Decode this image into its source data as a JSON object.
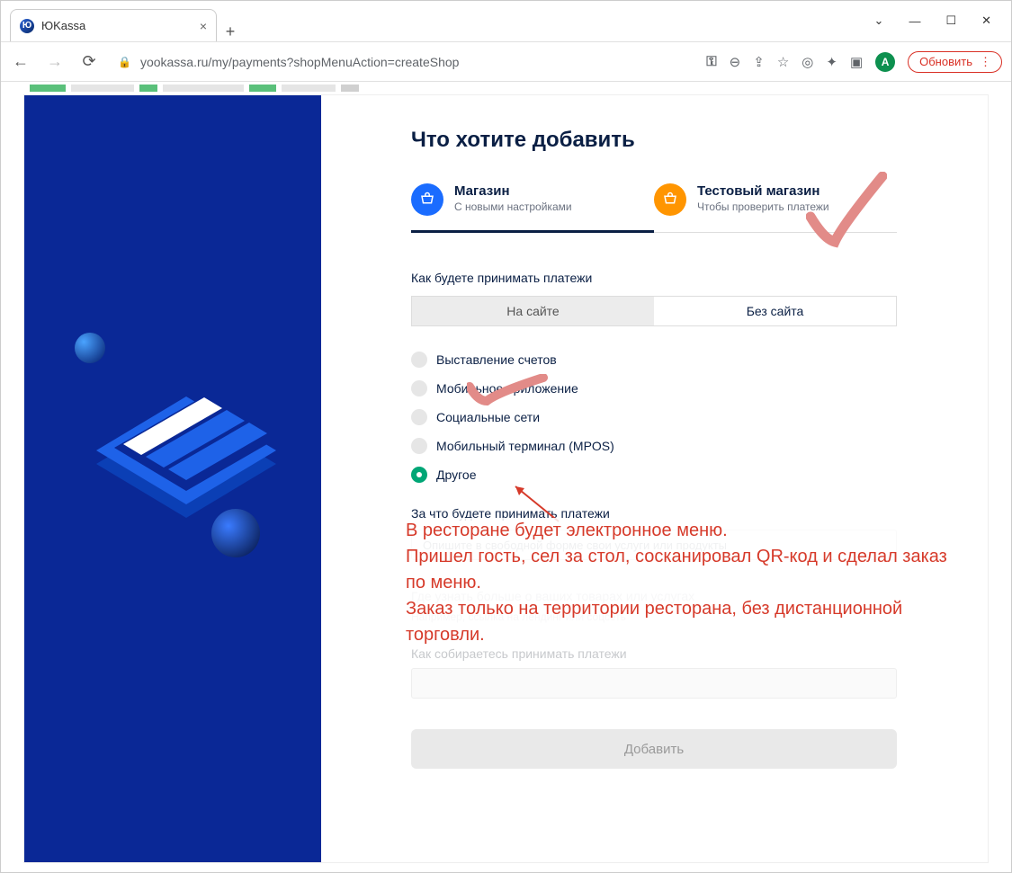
{
  "browser": {
    "tab_title": "ЮKassa",
    "url": "yookassa.ru/my/payments?shopMenuAction=createShop",
    "update_label": "Обновить",
    "avatar_letter": "A"
  },
  "page": {
    "title": "Что хотите добавить",
    "type_tabs": [
      {
        "title": "Магазин",
        "subtitle": "С новыми настройками",
        "active": true
      },
      {
        "title": "Тестовый магазин",
        "subtitle": "Чтобы проверить платежи",
        "active": false
      }
    ],
    "accept_label": "Как будете принимать платежи",
    "accept_options": [
      {
        "label": "На сайте",
        "selected": false
      },
      {
        "label": "Без сайта",
        "selected": true
      }
    ],
    "radios": [
      {
        "label": "Выставление счетов",
        "selected": false
      },
      {
        "label": "Мобильное приложение",
        "selected": false
      },
      {
        "label": "Социальные сети",
        "selected": false
      },
      {
        "label": "Мобильный терминал (MPOS)",
        "selected": false
      },
      {
        "label": "Другое",
        "selected": true
      }
    ],
    "desc_label": "За что будете принимать платежи",
    "desc_placeholder": "Опишите в свободной форме свои услуги или продукты",
    "ghost1_label": "Где узнать больше о ваших товарах или услугах",
    "ghost1_hint": "Например, ссылка на лендинг или соцсеть",
    "ghost2_label": "Как собираетесь принимать платежи",
    "submit_label": "Добавить"
  },
  "annotation": {
    "text": "В ресторане будет электронное меню.\nПришел гость, сел за стол, сосканировал QR-код и сделал заказ по меню.\nЗаказ только на территории ресторана, без дистанционной торговли."
  }
}
